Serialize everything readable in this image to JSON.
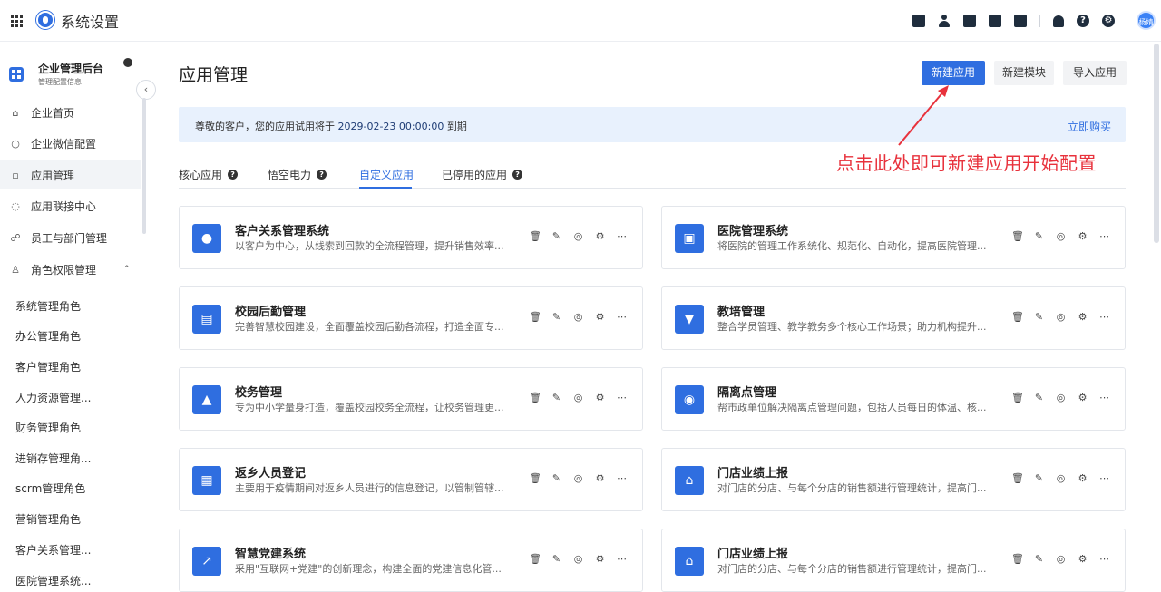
{
  "topbar": {
    "app_title": "系统设置",
    "avatar_text": "杨婧"
  },
  "sidebar": {
    "corp_name": "企业管理后台",
    "corp_sub": "管理配置信息",
    "nav": [
      {
        "label": "企业首页",
        "icon": "home-icon"
      },
      {
        "label": "企业微信配置",
        "icon": "wechat-icon"
      },
      {
        "label": "应用管理",
        "icon": "apps-icon"
      },
      {
        "label": "应用联接中心",
        "icon": "link-icon"
      },
      {
        "label": "员工与部门管理",
        "icon": "users-icon"
      },
      {
        "label": "角色权限管理",
        "icon": "role-icon"
      }
    ],
    "roles": [
      "系统管理角色",
      "办公管理角色",
      "客户管理角色",
      "人力资源管理...",
      "财务管理角色",
      "进销存管理角...",
      "scrm管理角色",
      "营销管理角色",
      "客户关系管理...",
      "医院管理系统..."
    ]
  },
  "main": {
    "title": "应用管理",
    "buttons": {
      "new_app": "新建应用",
      "new_module": "新建模块",
      "import_app": "导入应用"
    },
    "banner": {
      "prefix": "尊敬的客户，您的应用试用将于 ",
      "date": "2029-02-23 00:00:00",
      "suffix": " 到期",
      "link": "立即购买"
    },
    "annotation": "点击此处即可新建应用开始配置",
    "tabs": [
      "核心应用",
      "悟空电力",
      "自定义应用",
      "已停用的应用"
    ],
    "active_tab": "自定义应用",
    "cards": [
      {
        "title": "客户关系管理系统",
        "desc": "以客户为中心，从线索到回款的全流程管理，提升销售效率...",
        "icon": "user-icon"
      },
      {
        "title": "医院管理系统",
        "desc": "将医院的管理工作系统化、规范化、自动化，提高医院管理...",
        "icon": "medkit-icon"
      },
      {
        "title": "校园后勤管理",
        "desc": "完善智慧校园建设，全面覆盖校园后勤各流程，打造全面专...",
        "icon": "inbox-icon"
      },
      {
        "title": "教培管理",
        "desc": "整合学员管理、教学教务多个核心工作场景；助力机构提升...",
        "icon": "tie-icon"
      },
      {
        "title": "校务管理",
        "desc": "专为中小学量身打造，覆盖校园校务全流程，让校务管理更...",
        "icon": "graduation-cap-icon"
      },
      {
        "title": "隔离点管理",
        "desc": "帮市政单位解决隔离点管理问题，包括人员每日的体温、核...",
        "icon": "shield-icon"
      },
      {
        "title": "返乡人员登记",
        "desc": "主要用于疫情期间对返乡人员进行的信息登记，以管制管辖...",
        "icon": "clipboard-icon"
      },
      {
        "title": "门店业绩上报",
        "desc": "对门店的分店、与每个分店的销售额进行管理统计，提高门...",
        "icon": "store-icon"
      },
      {
        "title": "智慧党建系统",
        "desc": "采用\"互联网+党建\"的创新理念，构建全面的党建信息化管...",
        "icon": "chart-icon"
      },
      {
        "title": "门店业绩上报",
        "desc": "对门店的分店、与每个分店的销售额进行管理统计，提高门...",
        "icon": "store-icon"
      }
    ]
  }
}
